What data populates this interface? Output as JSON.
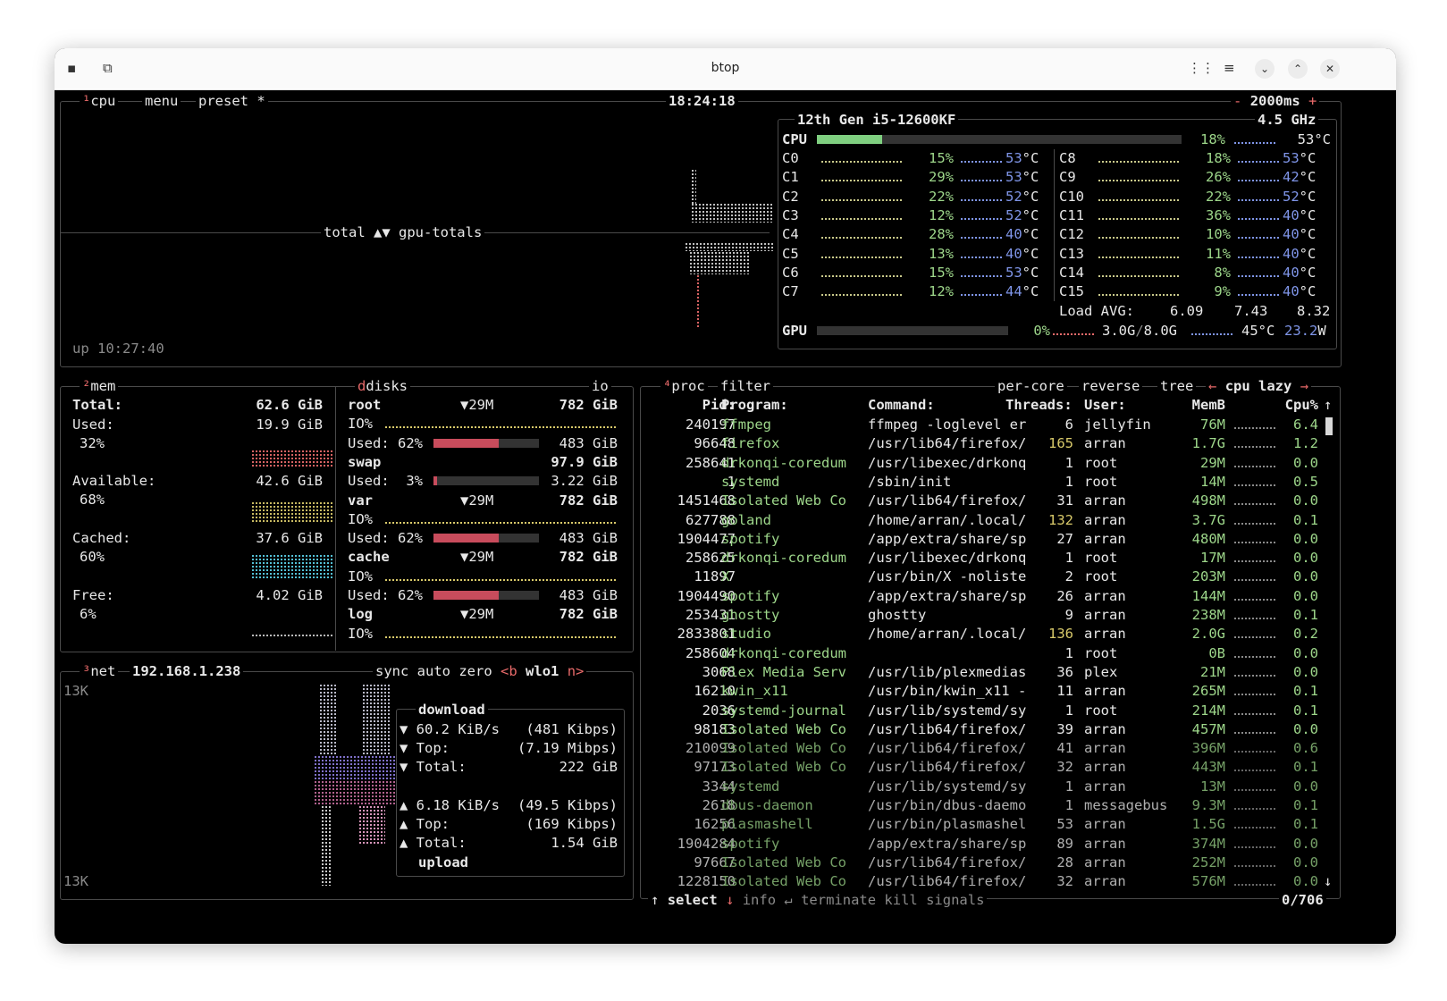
{
  "window": {
    "title": "btop"
  },
  "cpu_box": {
    "num": "¹",
    "label": "cpu",
    "menu": "menu",
    "preset": "preset *",
    "clock": "18:24:18",
    "interval_minus": "-",
    "interval": "2000ms",
    "interval_plus": "+",
    "graph_label": "total ▲▼ gpu-totals",
    "uptime": "up 10:27:40",
    "cpu_name": "12th Gen i5-12600KF",
    "freq": "4.5 GHz",
    "total": {
      "label": "CPU",
      "pct": "18%",
      "temp": "53°C",
      "fill": 0.18
    },
    "cores_left": [
      {
        "name": "C0",
        "pct": "15%",
        "temp": "53",
        "unit": "°C"
      },
      {
        "name": "C1",
        "pct": "29%",
        "temp": "53",
        "unit": "°C"
      },
      {
        "name": "C2",
        "pct": "22%",
        "temp": "52",
        "unit": "°C"
      },
      {
        "name": "C3",
        "pct": "12%",
        "temp": "52",
        "unit": "°C"
      },
      {
        "name": "C4",
        "pct": "28%",
        "temp": "40",
        "unit": "°C"
      },
      {
        "name": "C5",
        "pct": "13%",
        "temp": "40",
        "unit": "°C"
      },
      {
        "name": "C6",
        "pct": "15%",
        "temp": "53",
        "unit": "°C"
      },
      {
        "name": "C7",
        "pct": "12%",
        "temp": "44",
        "unit": "°C"
      }
    ],
    "cores_right": [
      {
        "name": "C8",
        "pct": "18%",
        "temp": "53",
        "unit": "°C"
      },
      {
        "name": "C9",
        "pct": "26%",
        "temp": "42",
        "unit": "°C"
      },
      {
        "name": "C10",
        "pct": "22%",
        "temp": "52",
        "unit": "°C"
      },
      {
        "name": "C11",
        "pct": "36%",
        "temp": "40",
        "unit": "°C"
      },
      {
        "name": "C12",
        "pct": "10%",
        "temp": "40",
        "unit": "°C"
      },
      {
        "name": "C13",
        "pct": "11%",
        "temp": "40",
        "unit": "°C"
      },
      {
        "name": "C14",
        "pct": "8%",
        "temp": "40",
        "unit": "°C"
      },
      {
        "name": "C15",
        "pct": "9%",
        "temp": "40",
        "unit": "°C"
      }
    ],
    "load_label": "Load AVG:",
    "load1": "6.09",
    "load5": "7.43",
    "load15": "8.32",
    "gpu": {
      "label": "GPU",
      "pct": "0%",
      "mem": "3.0G",
      "sep": "/",
      "mem_total": "8.0G",
      "temp": "45°C",
      "power": "23.2",
      "power_unit": "W"
    }
  },
  "mem_box": {
    "num": "²",
    "label": "mem",
    "rows": [
      {
        "label": "Total:",
        "value": "62.6 GiB"
      },
      {
        "label": "Used:",
        "value": "19.9 GiB",
        "pct": "32%"
      },
      {
        "label": "Available:",
        "value": "42.6 GiB",
        "pct": "68%"
      },
      {
        "label": "Cached:",
        "value": "37.6 GiB",
        "pct": "60%"
      },
      {
        "label": "Free:",
        "value": "4.02 GiB",
        "pct": "6%"
      }
    ]
  },
  "disks_box": {
    "label": "disks",
    "io_label": "io",
    "rows": [
      {
        "name": "root",
        "rate": "▼29M",
        "size": "782 GiB",
        "io": "IO%",
        "used": "Used: 62%",
        "used_val": "483 GiB",
        "fill": 0.62
      },
      {
        "name": "swap",
        "size": "97.9 GiB",
        "used": "Used:  3%",
        "used_val": "3.22 GiB",
        "fill": 0.03
      },
      {
        "name": "var",
        "rate": "▼29M",
        "size": "782 GiB",
        "io": "IO%",
        "used": "Used: 62%",
        "used_val": "483 GiB",
        "fill": 0.62
      },
      {
        "name": "cache",
        "rate": "▼29M",
        "size": "782 GiB",
        "io": "IO%",
        "used": "Used: 62%",
        "used_val": "483 GiB",
        "fill": 0.62
      },
      {
        "name": "log",
        "rate": "▼29M",
        "size": "782 GiB",
        "io": "IO%"
      }
    ]
  },
  "net_box": {
    "num": "³",
    "label": "net",
    "ip": "192.168.1.238",
    "sync": "sync",
    "auto": "auto",
    "zero": "zero",
    "back": "<b",
    "iface": "wlo1",
    "next": "n>",
    "scale_top": "13K",
    "scale_bottom": "13K",
    "download_label": "download",
    "upload_label": "upload",
    "dl_rate": "▼ 60.2 KiB/s",
    "dl_rate_bits": "(481 Kibps)",
    "dl_top": "▼ Top:",
    "dl_top_val": "(7.19 Mibps)",
    "dl_total": "▼ Total:",
    "dl_total_val": "222 GiB",
    "ul_rate": "▲ 6.18 KiB/s",
    "ul_rate_bits": "(49.5 Kibps)",
    "ul_top": "▲ Top:",
    "ul_top_val": "(169 Kibps)",
    "ul_total": "▲ Total:",
    "ul_total_val": "1.54 GiB"
  },
  "proc_box": {
    "num": "⁴",
    "label": "proc",
    "filter": "filter",
    "per_core": "per-core",
    "reverse": "reverse",
    "tree": "tree",
    "sort_left": "←",
    "sort": "cpu lazy",
    "sort_right": "→",
    "columns": {
      "pid": "Pid:",
      "program": "Program:",
      "command": "Command:",
      "threads": "Threads:",
      "user": "User:",
      "mem": "MemB",
      "cpu": "Cpu%"
    },
    "rows": [
      {
        "pid": "240197",
        "program": "ffmpeg",
        "command": "ffmpeg -loglevel er",
        "threads": "6",
        "user": "jellyfin",
        "mem": "76M",
        "cpu": "6.4"
      },
      {
        "pid": "96648",
        "program": "firefox",
        "command": "/usr/lib64/firefox/",
        "threads": "165",
        "user": "arran",
        "mem": "1.7G",
        "cpu": "1.2"
      },
      {
        "pid": "258641",
        "program": "drkonqi-coredum",
        "command": "/usr/libexec/drkonq",
        "threads": "1",
        "user": "root",
        "mem": "29M",
        "cpu": "0.0"
      },
      {
        "pid": "1",
        "program": "systemd",
        "command": "/sbin/init",
        "threads": "1",
        "user": "root",
        "mem": "14M",
        "cpu": "0.5"
      },
      {
        "pid": "1451468",
        "program": "Isolated Web Co",
        "command": "/usr/lib64/firefox/",
        "threads": "31",
        "user": "arran",
        "mem": "498M",
        "cpu": "0.0"
      },
      {
        "pid": "627788",
        "program": "goland",
        "command": "/home/arran/.local/",
        "threads": "132",
        "user": "arran",
        "mem": "3.7G",
        "cpu": "0.1"
      },
      {
        "pid": "1904477",
        "program": "spotify",
        "command": "/app/extra/share/sp",
        "threads": "27",
        "user": "arran",
        "mem": "480M",
        "cpu": "0.0"
      },
      {
        "pid": "258625",
        "program": "drkonqi-coredum",
        "command": "/usr/libexec/drkonq",
        "threads": "1",
        "user": "root",
        "mem": "17M",
        "cpu": "0.0"
      },
      {
        "pid": "11897",
        "program": "X",
        "command": "/usr/bin/X -noliste",
        "threads": "2",
        "user": "root",
        "mem": "203M",
        "cpu": "0.0"
      },
      {
        "pid": "1904490",
        "program": "spotify",
        "command": "/app/extra/share/sp",
        "threads": "26",
        "user": "arran",
        "mem": "144M",
        "cpu": "0.0"
      },
      {
        "pid": "253431",
        "program": "ghostty",
        "command": "ghostty",
        "threads": "9",
        "user": "arran",
        "mem": "238M",
        "cpu": "0.1"
      },
      {
        "pid": "2833801",
        "program": "studio",
        "command": "/home/arran/.local/",
        "threads": "136",
        "user": "arran",
        "mem": "2.0G",
        "cpu": "0.2"
      },
      {
        "pid": "258604",
        "program": "drkonqi-coredum",
        "command": "",
        "threads": "1",
        "user": "root",
        "mem": "0B",
        "cpu": "0.0"
      },
      {
        "pid": "3068",
        "program": "Plex Media Serv",
        "command": "/usr/lib/plexmedias",
        "threads": "36",
        "user": "plex",
        "mem": "21M",
        "cpu": "0.0"
      },
      {
        "pid": "16210",
        "program": "kwin_x11",
        "command": "/usr/bin/kwin_x11 -",
        "threads": "11",
        "user": "arran",
        "mem": "265M",
        "cpu": "0.1"
      },
      {
        "pid": "2036",
        "program": "systemd-journal",
        "command": "/usr/lib/systemd/sy",
        "threads": "1",
        "user": "root",
        "mem": "214M",
        "cpu": "0.1"
      },
      {
        "pid": "98183",
        "program": "Isolated Web Co",
        "command": "/usr/lib64/firefox/",
        "threads": "39",
        "user": "arran",
        "mem": "457M",
        "cpu": "0.0"
      },
      {
        "pid": "210099",
        "program": "Isolated Web Co",
        "command": "/usr/lib64/firefox/",
        "threads": "41",
        "user": "arran",
        "mem": "396M",
        "cpu": "0.6"
      },
      {
        "pid": "97173",
        "program": "Isolated Web Co",
        "command": "/usr/lib64/firefox/",
        "threads": "32",
        "user": "arran",
        "mem": "443M",
        "cpu": "0.1"
      },
      {
        "pid": "3344",
        "program": "systemd",
        "command": "/usr/lib/systemd/sy",
        "threads": "1",
        "user": "arran",
        "mem": "13M",
        "cpu": "0.0"
      },
      {
        "pid": "2618",
        "program": "dbus-daemon",
        "command": "/usr/bin/dbus-daemo",
        "threads": "1",
        "user": "messagebus",
        "mem": "9.3M",
        "cpu": "0.1"
      },
      {
        "pid": "16256",
        "program": "plasmashell",
        "command": "/usr/bin/plasmashel",
        "threads": "53",
        "user": "arran",
        "mem": "1.5G",
        "cpu": "0.1"
      },
      {
        "pid": "1904284",
        "program": "spotify",
        "command": "/app/extra/share/sp",
        "threads": "89",
        "user": "arran",
        "mem": "374M",
        "cpu": "0.0"
      },
      {
        "pid": "97667",
        "program": "Isolated Web Co",
        "command": "/usr/lib64/firefox/",
        "threads": "28",
        "user": "arran",
        "mem": "252M",
        "cpu": "0.0"
      },
      {
        "pid": "1228150",
        "program": "Isolated Web Co",
        "command": "/usr/lib64/firefox/",
        "threads": "32",
        "user": "arran",
        "mem": "576M",
        "cpu": "0.0"
      }
    ],
    "footer": {
      "up": "↑",
      "select": "select",
      "down": "↓",
      "info": "info",
      "enter": "↵",
      "terminate": "terminate",
      "kill": "kill",
      "signals": "signals",
      "count": "0/706"
    },
    "scroll_up": "↑",
    "scroll_down": "↓"
  },
  "colors": {
    "accent_red": "#e86a6a",
    "green": "#9dd68a",
    "blue": "#7f95e8",
    "yellow": "#d8c96a",
    "border": "#4a4a4a"
  }
}
